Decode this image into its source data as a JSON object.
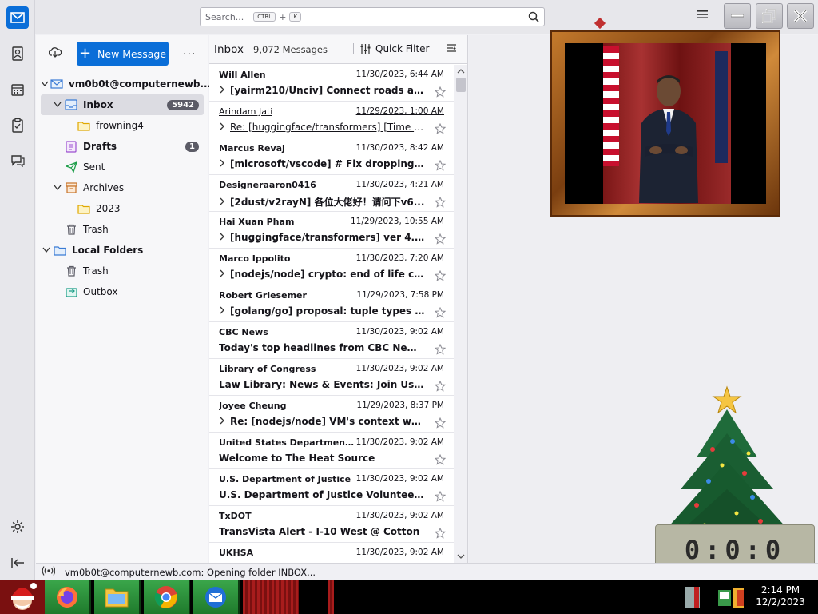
{
  "search": {
    "placeholder": "Search...",
    "key1": "CTRL",
    "plus": "+",
    "key2": "K"
  },
  "toolbar": {
    "new_message_label": "New Message",
    "more_label": "..."
  },
  "folders": [
    {
      "label": "vm0b0t@computernewb...",
      "type": "account"
    },
    {
      "label": "Inbox",
      "badge": "5942",
      "selected": true
    },
    {
      "label": "frowning4"
    },
    {
      "label": "Drafts",
      "badge": "1"
    },
    {
      "label": "Sent"
    },
    {
      "label": "Archives"
    },
    {
      "label": "2023"
    },
    {
      "label": "Trash"
    },
    {
      "label": "Local Folders",
      "type": "account"
    },
    {
      "label": "Trash"
    },
    {
      "label": "Outbox"
    }
  ],
  "message_list": {
    "folder_title": "Inbox",
    "message_count": "9,072 Messages",
    "quick_filter_label": "Quick Filter",
    "messages": [
      {
        "from": "Will Allen",
        "date": "11/30/2023, 6:44 AM",
        "subject": "[yairm210/Unciv] Connect roads auto...",
        "thread": true,
        "read": false
      },
      {
        "from": "Arindam Jati",
        "date": "11/29/2023, 1:00 AM",
        "subject": "Re: [huggingface/transformers] [Time se...",
        "thread": true,
        "read": true
      },
      {
        "from": "Marcus Revaj",
        "date": "11/30/2023, 8:42 AM",
        "subject": "[microsoft/vscode] # Fix dropping of...",
        "thread": true,
        "read": false
      },
      {
        "from": "Designeraaron0416",
        "date": "11/30/2023, 4:21 AM",
        "subject": "[2dust/v2rayN] 各位大佬好！请问下v6...",
        "thread": true,
        "read": false
      },
      {
        "from": "Hai Xuan Pham",
        "date": "11/29/2023, 10:55 AM",
        "subject": "[huggingface/transformers] ver 4.35....",
        "thread": true,
        "read": false
      },
      {
        "from": "Marco Ippolito",
        "date": "11/30/2023, 7:20 AM",
        "subject": "[nodejs/node] crypto: end of life cre...",
        "thread": true,
        "read": false
      },
      {
        "from": "Robert Griesemer",
        "date": "11/29/2023, 7:58 PM",
        "subject": "[golang/go] proposal: tuple types (Is...",
        "thread": true,
        "read": false
      },
      {
        "from": "CBC News",
        "date": "11/30/2023, 9:02 AM",
        "subject": "Today's top headlines from CBC Newfo...",
        "thread": false,
        "read": false
      },
      {
        "from": "Library of Congress",
        "date": "11/30/2023, 9:02 AM",
        "subject": "Law Library: News & Events: Join Us ne...",
        "thread": false,
        "read": false
      },
      {
        "from": "Joyee Cheung",
        "date": "11/29/2023, 8:37 PM",
        "subject": "Re: [nodejs/node] VM's context when...",
        "thread": true,
        "read": false
      },
      {
        "from": "United States Department ...",
        "date": "11/30/2023, 9:02 AM",
        "subject": "Welcome to The Heat Source",
        "thread": false,
        "read": false
      },
      {
        "from": "U.S. Department of Justice",
        "date": "11/30/2023, 9:02 AM",
        "subject": "U.S. Department of Justice Volunteer Le...",
        "thread": false,
        "read": false
      },
      {
        "from": "TxDOT",
        "date": "11/30/2023, 9:02 AM",
        "subject": "TransVista Alert - I-10 West @ Cotton",
        "thread": false,
        "read": false
      },
      {
        "from": "UKHSA",
        "date": "11/30/2023, 9:02 AM",
        "subject": "",
        "thread": false,
        "read": false
      }
    ]
  },
  "status": {
    "text": "vm0b0t@computernewb.com: Opening folder INBOX..."
  },
  "desktop": {
    "clock_widget": "0:0:0"
  },
  "taskbar": {
    "time": "2:14 PM",
    "date": "12/2/2023"
  },
  "colors": {
    "accent": "#0a6ed8"
  }
}
